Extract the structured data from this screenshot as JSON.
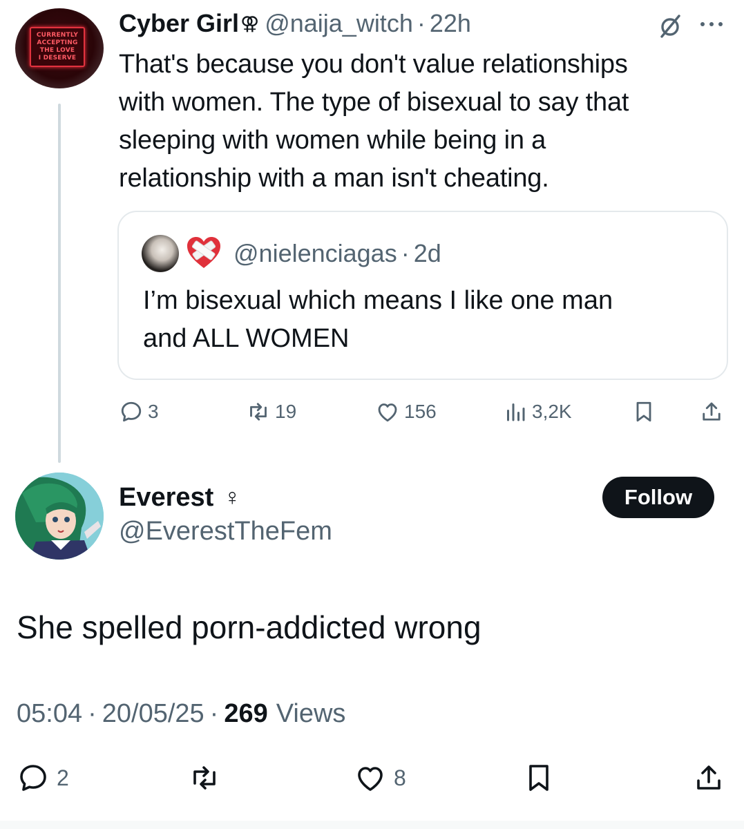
{
  "parent_tweet": {
    "display_name": "Cyber Girl",
    "name_glyph": "⚢",
    "handle": "@naija_witch",
    "dot": "·",
    "time": "22h",
    "avatar_sign": [
      "CURRENTLY",
      "ACCEPTING",
      "THE LOVE",
      "I DESERVE"
    ],
    "text_lines": [
      "That's because you don't value relationships",
      "with women. The type of bisexual to say that",
      "sleeping with women while being in a",
      "relationship with a man isn't cheating."
    ],
    "quote": {
      "handle": "@nielenciagas",
      "dot": "·",
      "time": "2d",
      "text_lines": [
        "I’m bisexual which means I like one man",
        "and ALL WOMEN"
      ]
    },
    "actions": {
      "replies": "3",
      "reposts": "19",
      "likes": "156",
      "views": "3,2K"
    },
    "icons": [
      "grok-icon",
      "more-icon",
      "reply-icon",
      "repost-icon",
      "like-icon",
      "views-icon",
      "bookmark-icon",
      "share-icon"
    ]
  },
  "main_tweet": {
    "display_name": "Everest",
    "name_glyph": "♀",
    "handle": "@EverestTheFem",
    "follow_label": "Follow",
    "text": "She spelled porn-addicted wrong",
    "time": "05:04",
    "date": "20/05/25",
    "sep": "·",
    "views_count": "269",
    "views_label": "Views",
    "actions": {
      "replies": "2",
      "likes": "8"
    },
    "icons": [
      "reply-icon",
      "repost-icon",
      "like-icon",
      "bookmark-icon",
      "share-icon"
    ]
  },
  "colors": {
    "text": "#0f1419",
    "secondary": "#536471",
    "border": "#e4e9ec",
    "thread_line": "#cfd9de",
    "follow_bg": "#0f1419",
    "follow_text": "#ffffff"
  }
}
